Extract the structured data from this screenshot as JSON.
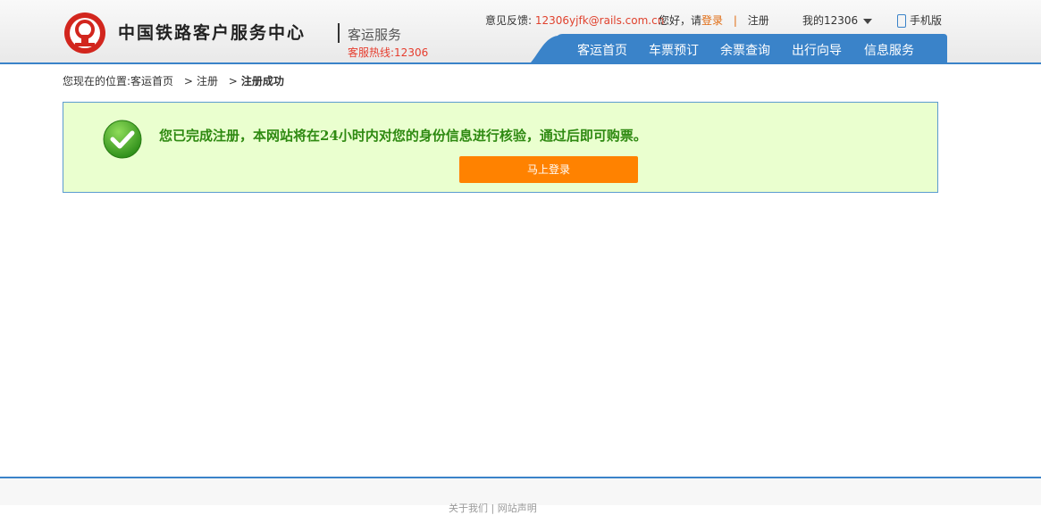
{
  "header": {
    "brand": "中国铁路客户服务中心",
    "service": "客运服务",
    "hotline": "客服热线:12306",
    "feedback_label": "意见反馈:",
    "feedback_email": "12306yjfk@rails.com.cn",
    "greeting": "您好，请",
    "login": "登录",
    "separator": "|",
    "register": "注册",
    "my12306": "我的12306",
    "mobile": "手机版",
    "nav": [
      "客运首页",
      "车票预订",
      "余票查询",
      "出行向导",
      "信息服务"
    ]
  },
  "breadcrumb": {
    "prefix": "您现在的位置:",
    "home": "客运首页",
    "sep1": ">",
    "register": "注册",
    "sep2": ">",
    "current": "注册成功"
  },
  "success": {
    "message": "您已完成注册，本网站将在24小时内对您的身份信息进行核验，通过后即可购票。",
    "login_button": "马上登录"
  },
  "footer": {
    "links": "关于我们 | 网站声明"
  },
  "colors": {
    "accent_blue": "#3a83c9",
    "orange": "#ff8200",
    "success_green": "#2f8a12",
    "panel_bg": "#eaffcf"
  }
}
